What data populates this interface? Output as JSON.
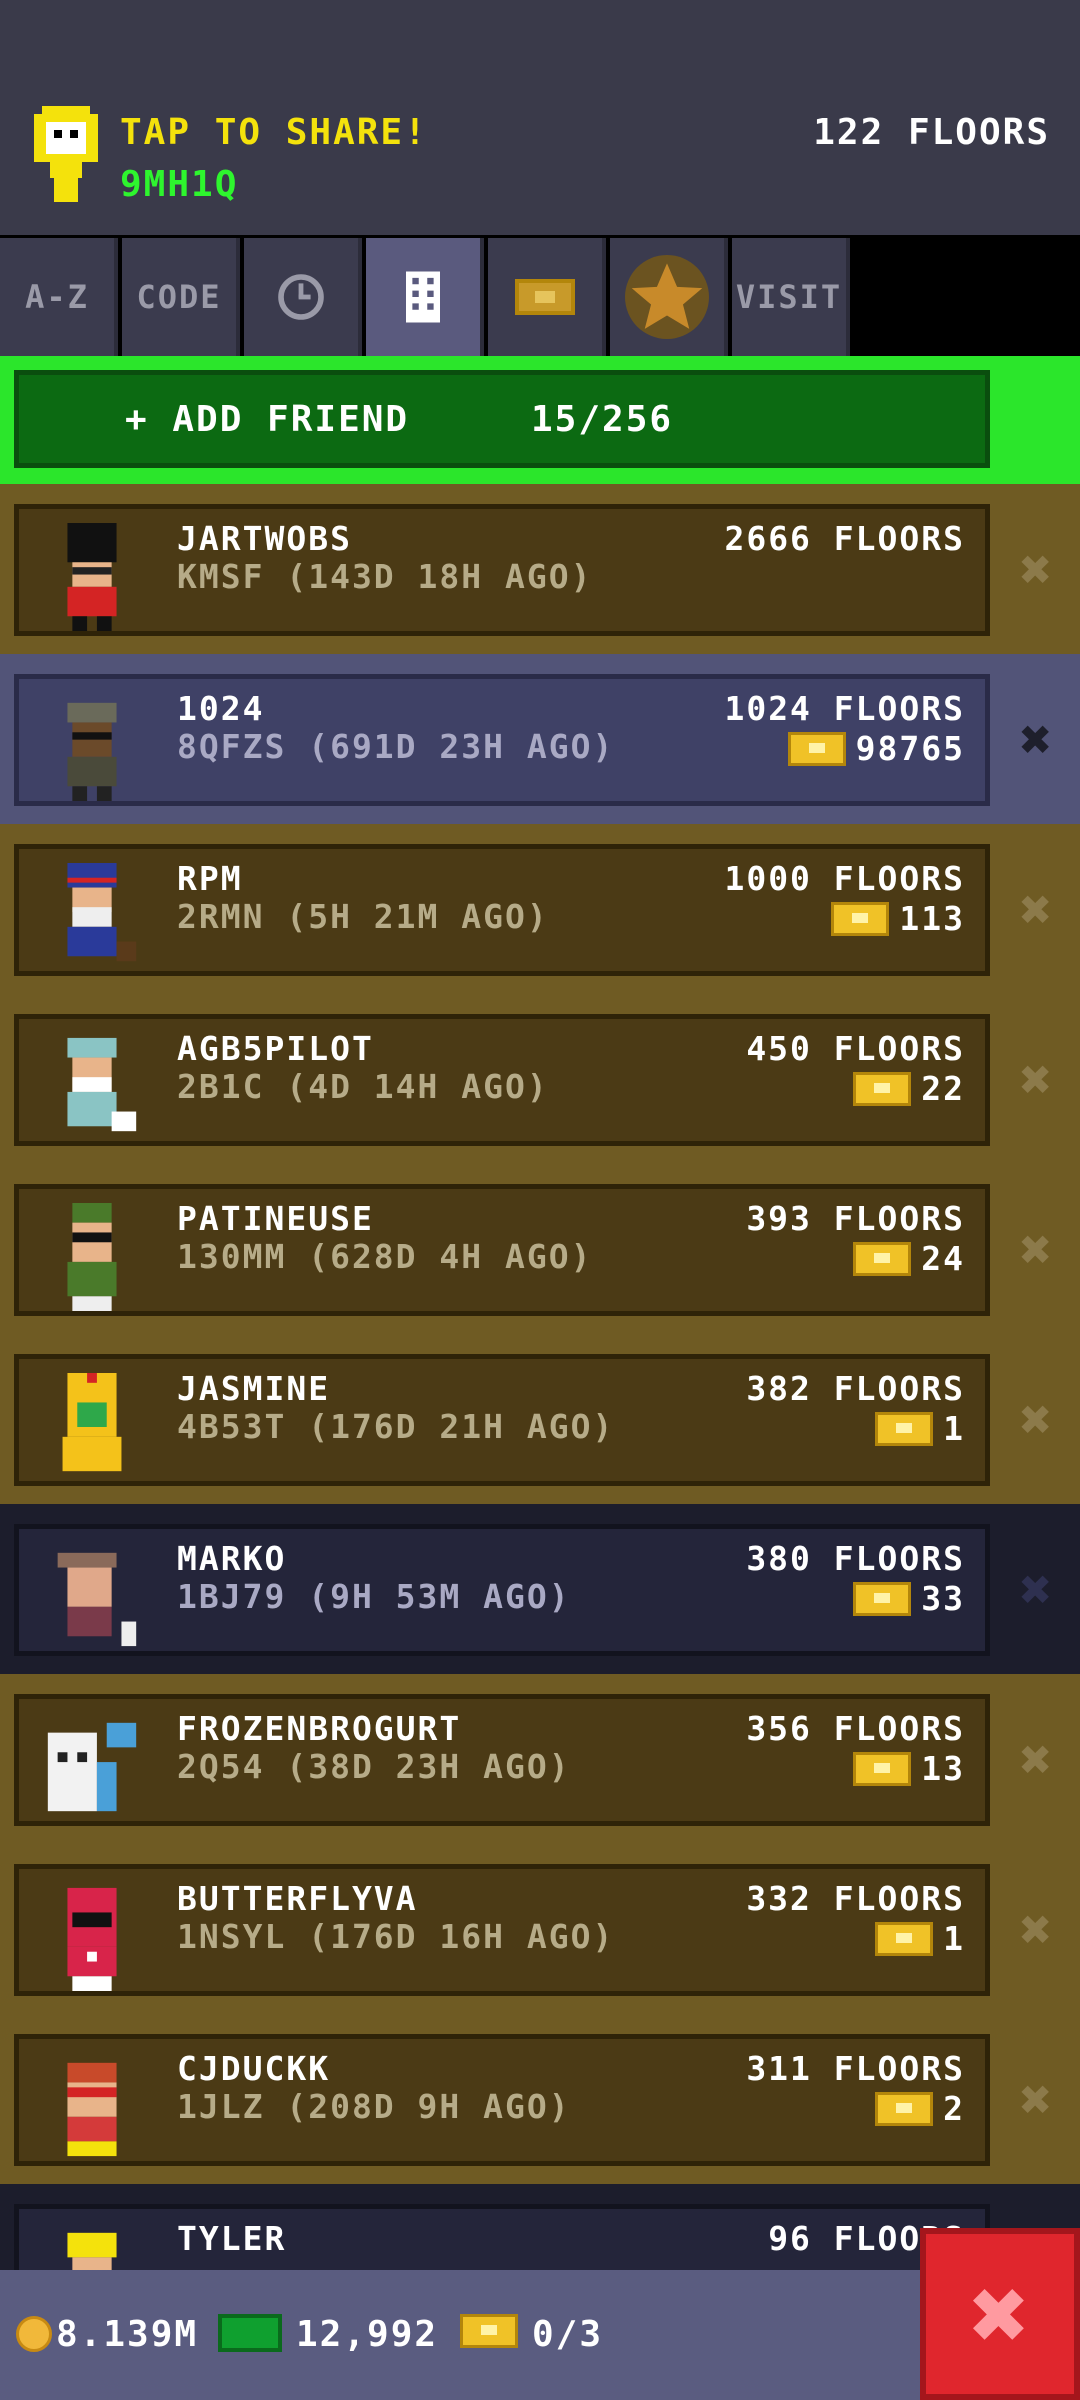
{
  "header": {
    "share_title": "TAP TO SHARE!",
    "share_code": "9MH1Q",
    "floors": "122 FLOORS"
  },
  "tabs": [
    {
      "label": "A-Z",
      "icon": null
    },
    {
      "label": "CODE",
      "icon": null
    },
    {
      "label": "",
      "icon": "clock-icon"
    },
    {
      "label": "",
      "icon": "building-icon",
      "active": true
    },
    {
      "label": "",
      "icon": "ticket-icon"
    },
    {
      "label": "",
      "icon": "star-icon"
    },
    {
      "label": "VISIT",
      "icon": null
    }
  ],
  "add_friend": {
    "label": "+ ADD FRIEND",
    "count": "15/256"
  },
  "friends": [
    {
      "name": "JARTWOBS",
      "sub": "KMSF (143D 18H AGO)",
      "floors": "2666 FLOORS",
      "bux": "",
      "style": "gold"
    },
    {
      "name": "1024",
      "sub": "8QFZS (691D 23H AGO)",
      "floors": "1024 FLOORS",
      "bux": "98765",
      "style": "blue"
    },
    {
      "name": "RPM",
      "sub": "2RMN (5H 21M AGO)",
      "floors": "1000 FLOORS",
      "bux": "113",
      "style": "gold"
    },
    {
      "name": "AGB5PILOT",
      "sub": "2B1C (4D 14H AGO)",
      "floors": "450 FLOORS",
      "bux": "22",
      "style": "gold"
    },
    {
      "name": "PATINEUSE",
      "sub": "130MM (628D 4H AGO)",
      "floors": "393 FLOORS",
      "bux": "24",
      "style": "gold"
    },
    {
      "name": "JASMINE",
      "sub": "4B53T (176D 21H AGO)",
      "floors": "382 FLOORS",
      "bux": "1",
      "style": "gold"
    },
    {
      "name": "MARKO",
      "sub": "1BJ79 (9H 53M AGO)",
      "floors": "380 FLOORS",
      "bux": "33",
      "style": "navy"
    },
    {
      "name": "FROZENBROGURT",
      "sub": "2Q54 (38D 23H AGO)",
      "floors": "356 FLOORS",
      "bux": "13",
      "style": "gold"
    },
    {
      "name": "BUTTERFLYVA",
      "sub": "1NSYL (176D 16H AGO)",
      "floors": "332 FLOORS",
      "bux": "1",
      "style": "gold"
    },
    {
      "name": "CJDUCKK",
      "sub": "1JLZ (208D 9H AGO)",
      "floors": "311 FLOORS",
      "bux": "2",
      "style": "gold"
    },
    {
      "name": "TYLER",
      "sub": "",
      "floors": "96 FLOORS",
      "bux": "",
      "style": "navy"
    }
  ],
  "footer": {
    "coins": "8.139M",
    "bux": "12,992",
    "tickets": "0/3"
  },
  "colors": {
    "gold_row": "#6f5b23",
    "blue_row": "#525478",
    "green_bar": "#2be62b",
    "yellow_text": "#f4e20c",
    "green_text": "#2ef52e",
    "close_red": "#e0262d"
  }
}
